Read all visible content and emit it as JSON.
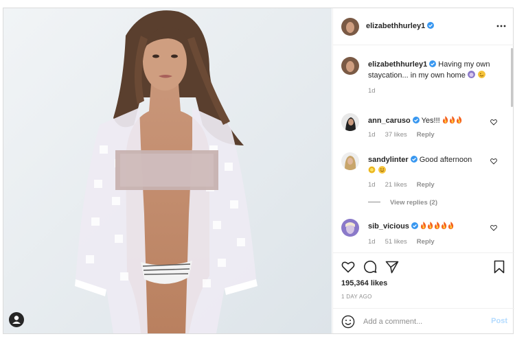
{
  "post": {
    "author": "elizabethhurley1",
    "caption_author": "elizabethhurley1",
    "caption_text": "Having my own staycation... in my own home",
    "caption_time": "1d",
    "likes": "195,364 likes",
    "timestamp": "1 DAY AGO",
    "accent": "#0095f6",
    "verified_color": "#3897f0"
  },
  "comments": [
    {
      "user": "ann_caruso",
      "text": "Yes!!!",
      "time": "1d",
      "likes": "37 likes",
      "reply": "Reply",
      "icons": [
        "fire-emoji",
        "fire-emoji",
        "fire-emoji"
      ]
    },
    {
      "user": "sandylinter",
      "text": "Good afternoon",
      "time": "1d",
      "likes": "21 likes",
      "reply": "Reply",
      "icons": [
        "sun-face-emoji",
        "smiling-face-emoji"
      ]
    },
    {
      "user": "sib_vicious",
      "text": "",
      "time": "1d",
      "likes": "51 likes",
      "reply": "Reply",
      "icons": [
        "fire-emoji",
        "fire-emoji",
        "fire-emoji",
        "fire-emoji",
        "fire-emoji"
      ]
    }
  ],
  "view_replies": "View replies (2)",
  "add_comment": {
    "placeholder": "Add a comment...",
    "post_label": "Post"
  },
  "icons": {
    "more": "more-options-icon",
    "like": "heart-icon",
    "comment": "comment-icon",
    "share": "share-icon",
    "save": "bookmark-icon",
    "emoji": "smile-icon",
    "tag": "user-tag-icon"
  }
}
